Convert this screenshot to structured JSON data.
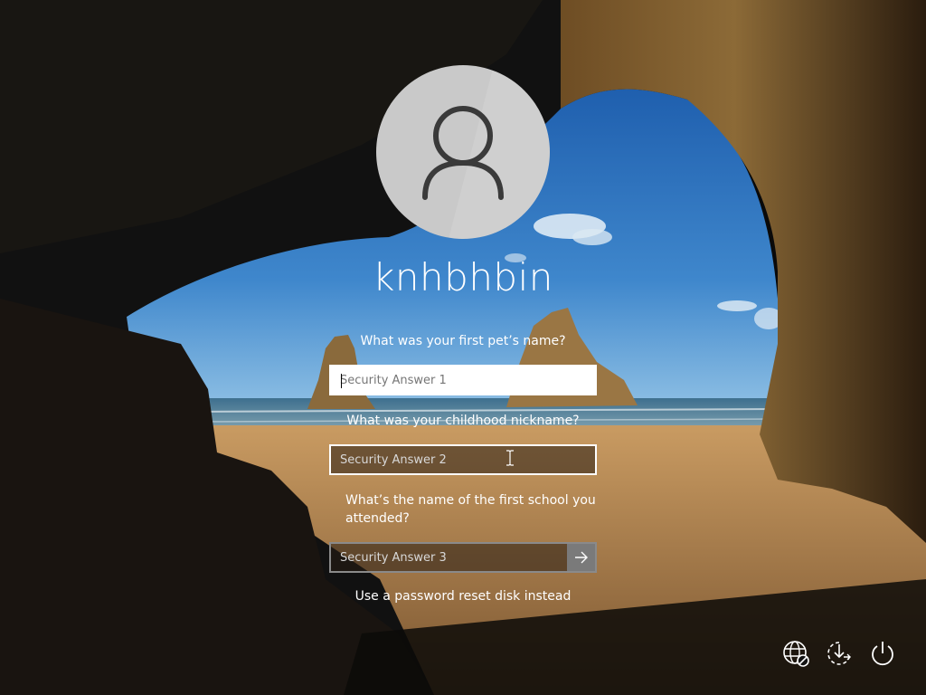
{
  "user": {
    "name": "knhbhbin",
    "avatar_icon": "user-silhouette-icon"
  },
  "security_questions": [
    {
      "question": "What was your first pet’s name?",
      "placeholder": "Security Answer 1",
      "value": ""
    },
    {
      "question": "What was your childhood nickname?",
      "placeholder": "Security Answer 2",
      "value": ""
    },
    {
      "question": "What’s the name of the first school you attended?",
      "placeholder": "Security Answer 3",
      "value": ""
    }
  ],
  "submit": {
    "icon": "arrow-right-icon"
  },
  "reset_link": "Use a password reset disk instead",
  "corner_buttons": [
    {
      "icon": "network-icon"
    },
    {
      "icon": "ease-of-access-icon"
    },
    {
      "icon": "power-icon"
    }
  ],
  "colors": {
    "text": "#ffffff",
    "avatar_bg": "#c9c9c9",
    "submit_bg": "#7a7a7a",
    "sky": "#2f74c0",
    "sand": "#b78a55"
  }
}
